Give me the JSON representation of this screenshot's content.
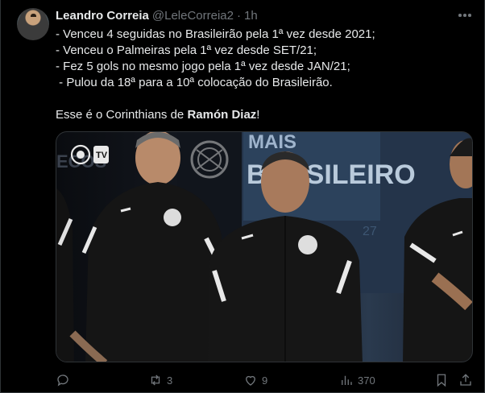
{
  "author": {
    "name": "Leandro Correia",
    "handle": "@LeleCorreia2",
    "separator": "·",
    "time": "1h"
  },
  "tweet": {
    "lines": [
      "- Venceu 4 seguidas no Brasileirão pela 1ª vez desde 2021;",
      "- Venceu o Palmeiras pela 1ª vez desde SET/21;",
      "- Fez 5 gols no mesmo jogo pela 1ª vez desde JAN/21;",
      " - Pulou da 18ª para a 10ª colocação do Brasileirão."
    ],
    "closing_prefix": "Esse é o Corinthians de ",
    "closing_bold": "Ramón Diaz",
    "closing_suffix": "!"
  },
  "media": {
    "overlay_badge": "TV",
    "banner_text_1": "MAIS",
    "banner_text_2": "BRASILEIRO",
    "background_text": "ECOS",
    "wall_number": "27",
    "colors": {
      "kit": "#141414",
      "stripe": "#e8e8e8",
      "wall": "#24344a"
    }
  },
  "actions": {
    "reply_count": "",
    "retweet_count": "3",
    "like_count": "9",
    "views_count": "370"
  },
  "icons": [
    "avatar",
    "more-icon",
    "reply-icon",
    "retweet-icon",
    "like-icon",
    "views-icon",
    "bookmark-icon",
    "share-icon"
  ],
  "theme": {
    "background": "#000000",
    "text": "#e7e9ea",
    "muted": "#71767b",
    "border": "#2f3336"
  }
}
